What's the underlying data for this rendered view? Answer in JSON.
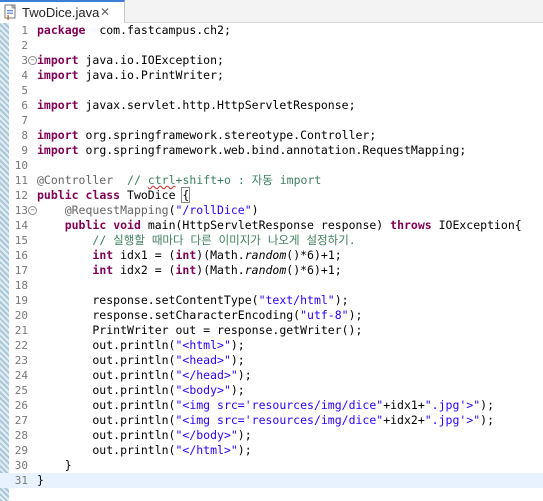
{
  "tab": {
    "title": "TwoDice.java",
    "close_glyph": "✕",
    "icon": "java-file-icon"
  },
  "editor": {
    "current_line": 31,
    "colors": {
      "keyword": "#7f0055",
      "string": "#2a00ff",
      "comment": "#3f7f5f",
      "annotation": "#646464",
      "line_number": "#787878",
      "current_line_bg": "#e8f2fe"
    },
    "lines": [
      {
        "n": "1",
        "fold": "",
        "tokens": [
          [
            "kw",
            "package"
          ],
          [
            "",
            "  com.fastcampus.ch2;"
          ]
        ]
      },
      {
        "n": "2",
        "fold": "",
        "tokens": []
      },
      {
        "n": "3",
        "fold": "⊖",
        "tokens": [
          [
            "kw",
            "import"
          ],
          [
            "",
            " java.io.IOException;"
          ]
        ]
      },
      {
        "n": "4",
        "fold": "",
        "tokens": [
          [
            "kw",
            "import"
          ],
          [
            "",
            " java.io.PrintWriter;"
          ]
        ]
      },
      {
        "n": "5",
        "fold": "",
        "tokens": []
      },
      {
        "n": "6",
        "fold": "",
        "tokens": [
          [
            "kw",
            "import"
          ],
          [
            "",
            " javax.servlet.http.HttpServletResponse;"
          ]
        ]
      },
      {
        "n": "7",
        "fold": "",
        "tokens": []
      },
      {
        "n": "8",
        "fold": "",
        "tokens": [
          [
            "kw",
            "import"
          ],
          [
            "",
            " org.springframework.stereotype.Controller;"
          ]
        ]
      },
      {
        "n": "9",
        "fold": "",
        "tokens": [
          [
            "kw",
            "import"
          ],
          [
            "",
            " org.springframework.web.bind.annotation.RequestMapping;"
          ]
        ]
      },
      {
        "n": "10",
        "fold": "",
        "tokens": []
      },
      {
        "n": "11",
        "fold": "",
        "tokens": [
          [
            "ann",
            "@Controller"
          ],
          [
            "",
            " "
          ],
          [
            "cm",
            " // "
          ],
          [
            "cm ul",
            "ctrl"
          ],
          [
            "cm",
            "+shift+o : 자동 import"
          ]
        ]
      },
      {
        "n": "12",
        "fold": "",
        "tokens": [
          [
            "kw",
            "public"
          ],
          [
            "",
            " "
          ],
          [
            "kw",
            "class"
          ],
          [
            "",
            " TwoDice "
          ],
          [
            "bracket",
            "{"
          ]
        ]
      },
      {
        "n": "13",
        "fold": "⊖",
        "tokens": [
          [
            "",
            "    "
          ],
          [
            "ann",
            "@RequestMapping"
          ],
          [
            "",
            "("
          ],
          [
            "str",
            "\"/rollDice\""
          ],
          [
            "",
            ")"
          ]
        ]
      },
      {
        "n": "14",
        "fold": "",
        "tokens": [
          [
            "",
            "    "
          ],
          [
            "kw",
            "public"
          ],
          [
            "",
            " "
          ],
          [
            "kw",
            "void"
          ],
          [
            "",
            " main(HttpServletResponse response) "
          ],
          [
            "kw",
            "throws"
          ],
          [
            "",
            " IOException{"
          ]
        ]
      },
      {
        "n": "15",
        "fold": "",
        "tokens": [
          [
            "",
            "        "
          ],
          [
            "cm",
            "// 실행할 때마다 다른 이미지가 나오게 설정하기."
          ]
        ]
      },
      {
        "n": "16",
        "fold": "",
        "tokens": [
          [
            "",
            "        "
          ],
          [
            "kw",
            "int"
          ],
          [
            "",
            " idx1 = ("
          ],
          [
            "kw",
            "int"
          ],
          [
            "",
            ")(Math."
          ],
          [
            "it",
            "random"
          ],
          [
            "",
            "()*6)+1;"
          ]
        ]
      },
      {
        "n": "17",
        "fold": "",
        "tokens": [
          [
            "",
            "        "
          ],
          [
            "kw",
            "int"
          ],
          [
            "",
            " idx2 = ("
          ],
          [
            "kw",
            "int"
          ],
          [
            "",
            ")(Math."
          ],
          [
            "it",
            "random"
          ],
          [
            "",
            "()*6)+1;"
          ]
        ]
      },
      {
        "n": "18",
        "fold": "",
        "tokens": []
      },
      {
        "n": "19",
        "fold": "",
        "tokens": [
          [
            "",
            "        response.setContentType("
          ],
          [
            "str",
            "\"text/html\""
          ],
          [
            "",
            ");"
          ]
        ]
      },
      {
        "n": "20",
        "fold": "",
        "tokens": [
          [
            "",
            "        response.setCharacterEncoding("
          ],
          [
            "str",
            "\"utf-8\""
          ],
          [
            "",
            ");"
          ]
        ]
      },
      {
        "n": "21",
        "fold": "",
        "tokens": [
          [
            "",
            "        PrintWriter out = response.getWriter();"
          ]
        ]
      },
      {
        "n": "22",
        "fold": "",
        "tokens": [
          [
            "",
            "        out.println("
          ],
          [
            "str",
            "\"<html>\""
          ],
          [
            "",
            ");"
          ]
        ]
      },
      {
        "n": "23",
        "fold": "",
        "tokens": [
          [
            "",
            "        out.println("
          ],
          [
            "str",
            "\"<head>\""
          ],
          [
            "",
            ");"
          ]
        ]
      },
      {
        "n": "24",
        "fold": "",
        "tokens": [
          [
            "",
            "        out.println("
          ],
          [
            "str",
            "\"</head>\""
          ],
          [
            "",
            ");"
          ]
        ]
      },
      {
        "n": "25",
        "fold": "",
        "tokens": [
          [
            "",
            "        out.println("
          ],
          [
            "str",
            "\"<body>\""
          ],
          [
            "",
            ");"
          ]
        ]
      },
      {
        "n": "26",
        "fold": "",
        "tokens": [
          [
            "",
            "        out.println("
          ],
          [
            "str",
            "\"<img src='resources/img/dice\""
          ],
          [
            "",
            "+idx1+"
          ],
          [
            "str",
            "\".jpg'>\""
          ],
          [
            "",
            ");"
          ]
        ]
      },
      {
        "n": "27",
        "fold": "",
        "tokens": [
          [
            "",
            "        out.println("
          ],
          [
            "str",
            "\"<img src='resources/img/dice\""
          ],
          [
            "",
            "+idx2+"
          ],
          [
            "str",
            "\".jpg'>\""
          ],
          [
            "",
            ");"
          ]
        ]
      },
      {
        "n": "28",
        "fold": "",
        "tokens": [
          [
            "",
            "        out.println("
          ],
          [
            "str",
            "\"</body>\""
          ],
          [
            "",
            ");"
          ]
        ]
      },
      {
        "n": "29",
        "fold": "",
        "tokens": [
          [
            "",
            "        out.println("
          ],
          [
            "str",
            "\"</html>\""
          ],
          [
            "",
            ");"
          ]
        ]
      },
      {
        "n": "30",
        "fold": "",
        "tokens": [
          [
            "",
            "    }"
          ]
        ]
      },
      {
        "n": "31",
        "fold": "",
        "tokens": [
          [
            "",
            "}"
          ]
        ]
      }
    ]
  }
}
